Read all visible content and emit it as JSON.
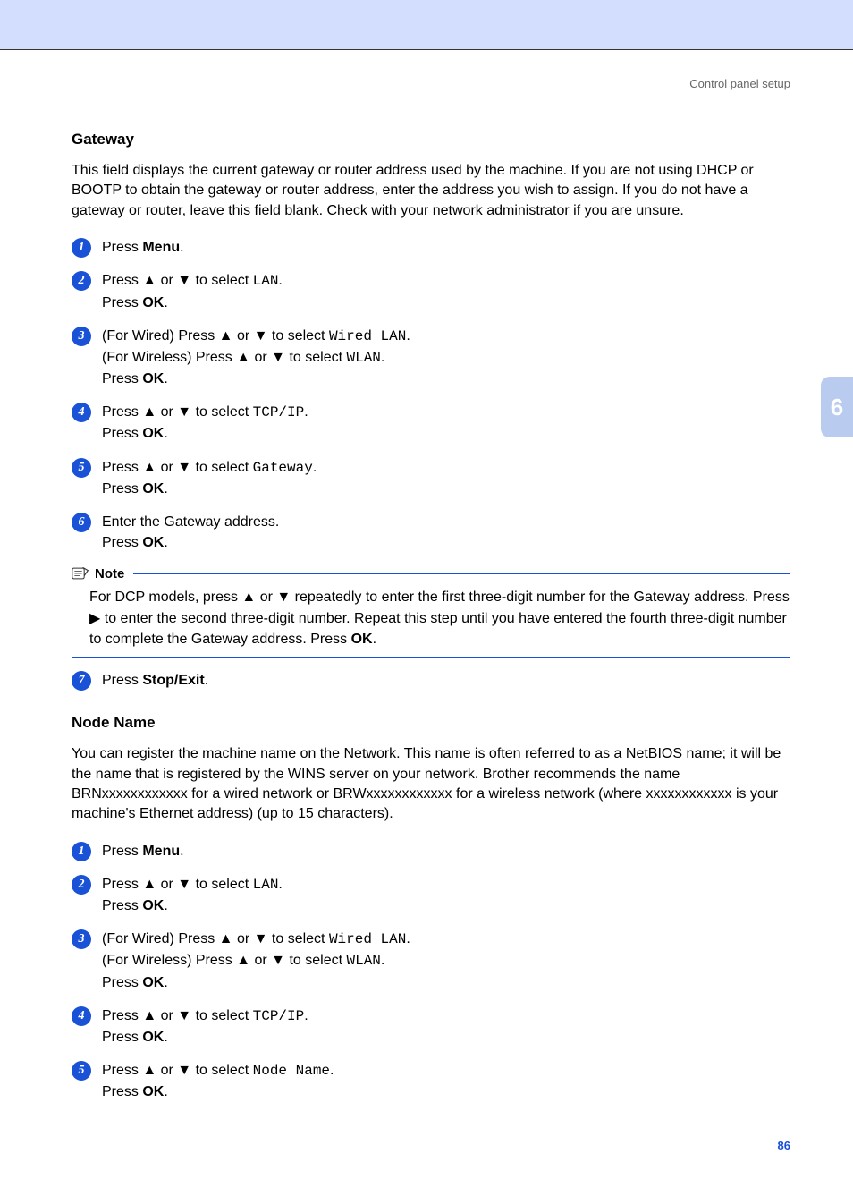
{
  "header": {
    "breadcrumb": "Control panel setup"
  },
  "chapter_tab": "6",
  "page_number": "86",
  "symbols": {
    "up": "▲",
    "down": "▼",
    "right": "▶",
    "press_up_or_down": "Press ▲ or ▼ to select ",
    "press_ok": "Press ",
    "ok": "OK",
    "menu": "Menu",
    "stop_exit": "Stop/Exit"
  },
  "gateway": {
    "heading": "Gateway",
    "intro": "This field displays the current gateway or router address used by the machine. If you are not using DHCP or BOOTP to obtain the gateway or router address, enter the address you wish to assign. If you do not have a gateway or router, leave this field blank. Check with your network administrator if you are unsure.",
    "steps": {
      "s1": {
        "n": "1",
        "pre": "Press ",
        "bold": "Menu",
        "post": "."
      },
      "s2": {
        "n": "2",
        "select_mono": "LAN",
        "dot": "."
      },
      "s3": {
        "n": "3",
        "line1_pre": "(For Wired) Press ▲ or ▼ to select ",
        "line1_mono": "Wired LAN",
        "line1_post": ".",
        "line2_pre": "(For Wireless) Press ▲ or ▼ to select ",
        "line2_mono": "WLAN",
        "line2_post": "."
      },
      "s4": {
        "n": "4",
        "select_mono": "TCP/IP",
        "dot": "."
      },
      "s5": {
        "n": "5",
        "select_mono": "Gateway",
        "dot": "."
      },
      "s6": {
        "n": "6",
        "text": "Enter the Gateway address."
      },
      "s7": {
        "n": "7",
        "pre": "Press ",
        "bold": "Stop/Exit",
        "post": "."
      }
    },
    "note": {
      "label": "Note",
      "body_pre": "For DCP models, press ▲ or ▼ repeatedly to enter the first three-digit number for the Gateway address. Press ▶ to enter the second three-digit number. Repeat this step until you have entered the fourth three-digit number to complete the Gateway address. Press ",
      "body_bold": "OK",
      "body_post": "."
    }
  },
  "nodename": {
    "heading": "Node Name",
    "intro": "You can register the machine name on the Network. This name is often referred to as a NetBIOS name; it will be the name that is registered by the WINS server on your network. Brother recommends the name BRNxxxxxxxxxxxx for a wired network or BRWxxxxxxxxxxxx for a wireless network (where xxxxxxxxxxxx is your machine's Ethernet address) (up to 15 characters).",
    "steps": {
      "s1": {
        "n": "1",
        "pre": "Press ",
        "bold": "Menu",
        "post": "."
      },
      "s2": {
        "n": "2",
        "select_mono": "LAN",
        "dot": "."
      },
      "s3": {
        "n": "3",
        "line1_pre": "(For Wired) Press ▲ or ▼ to select ",
        "line1_mono": "Wired LAN",
        "line1_post": ".",
        "line2_pre": "(For Wireless) Press ▲ or ▼ to select ",
        "line2_mono": "WLAN",
        "line2_post": "."
      },
      "s4": {
        "n": "4",
        "select_mono": "TCP/IP",
        "dot": "."
      },
      "s5": {
        "n": "5",
        "select_mono": "Node Name",
        "dot": "."
      }
    }
  }
}
